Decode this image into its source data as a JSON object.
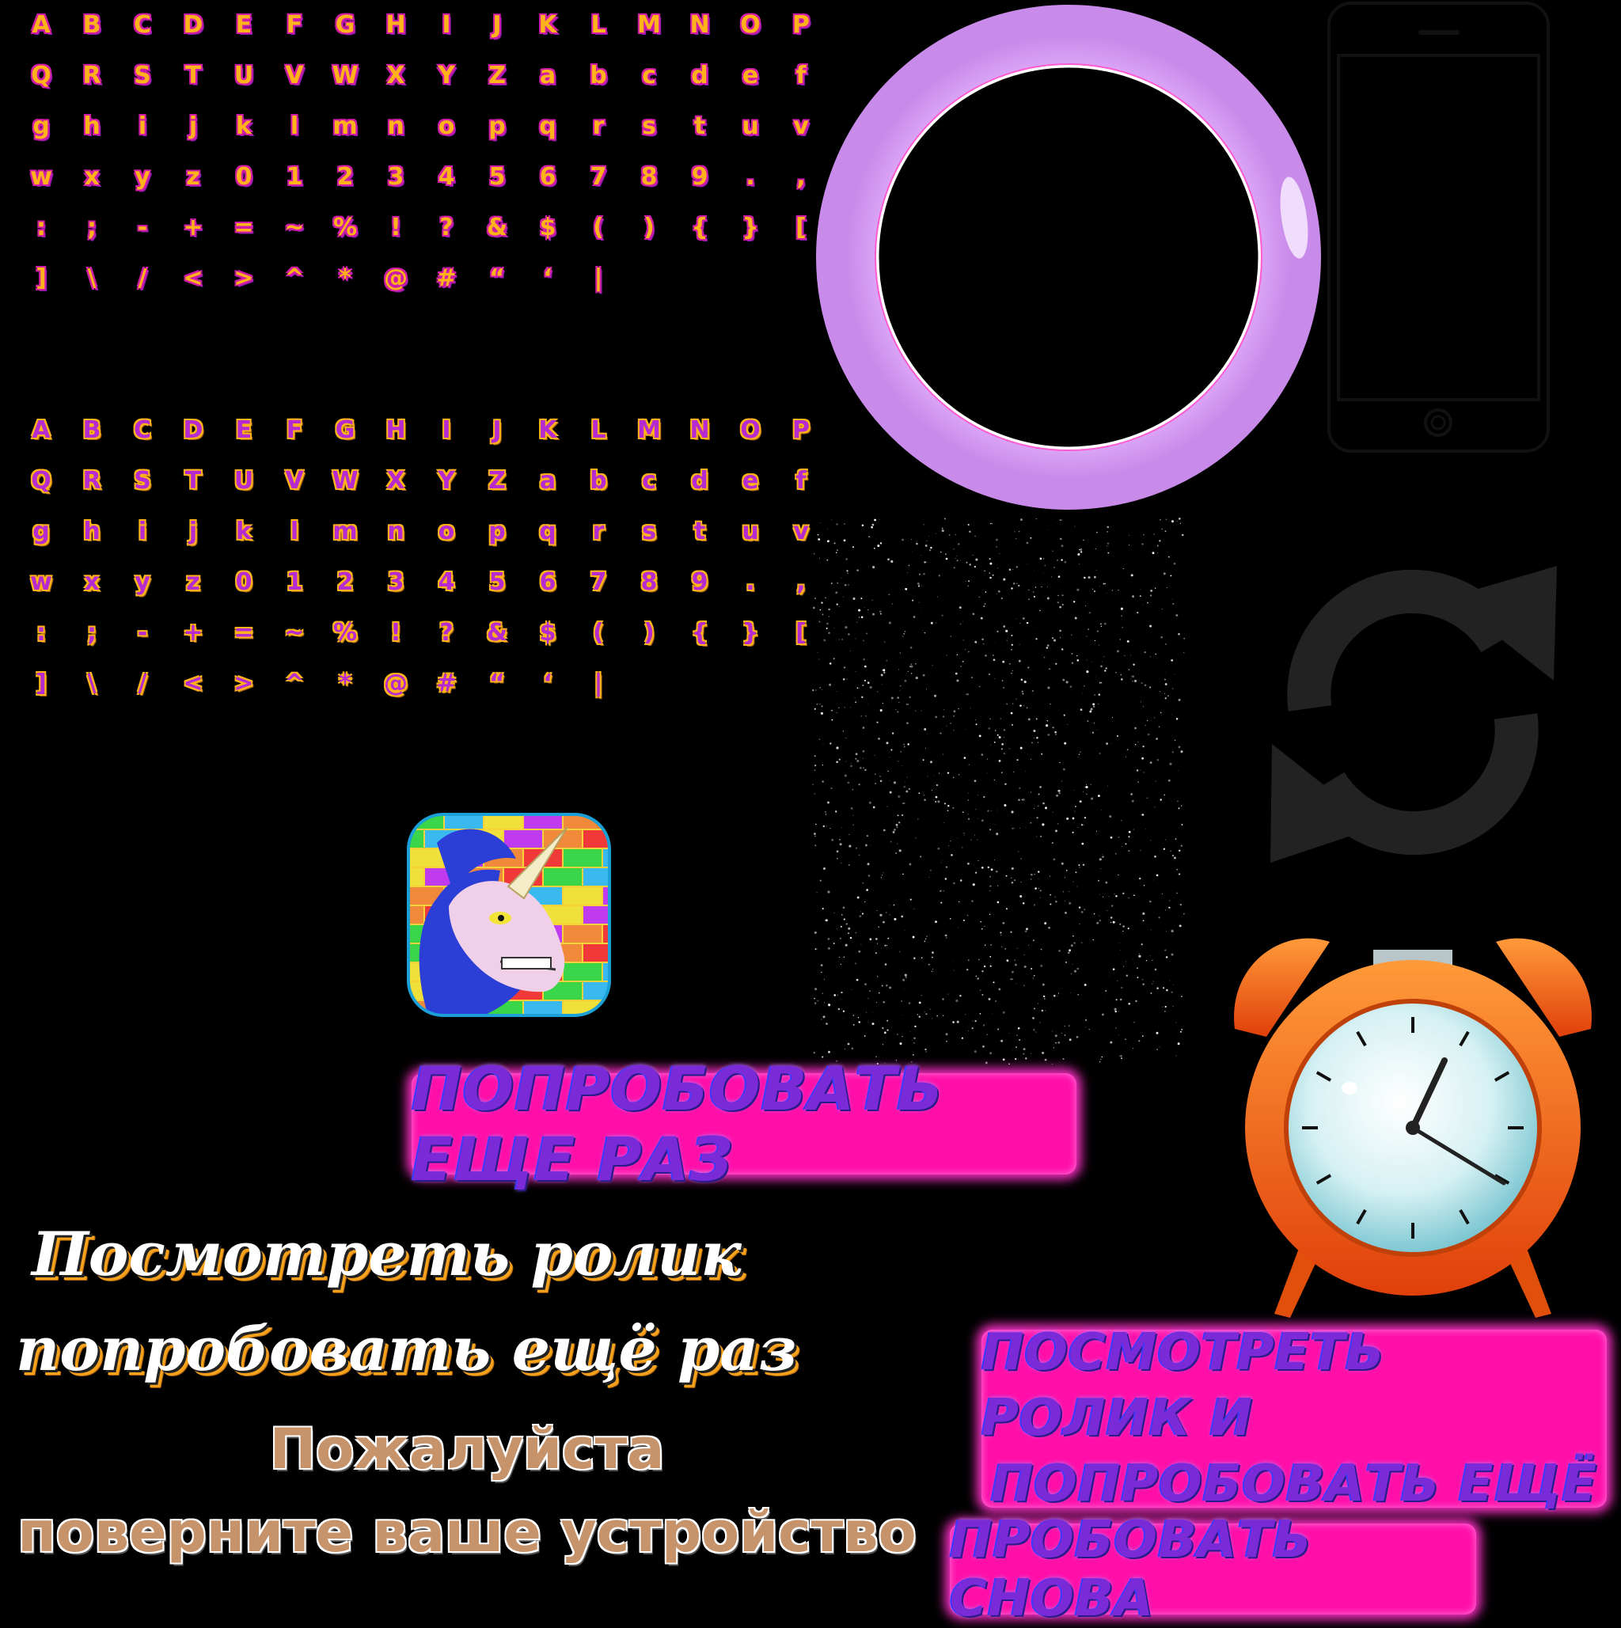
{
  "fonts": {
    "pink_set": [
      "A",
      "B",
      "C",
      "D",
      "E",
      "F",
      "G",
      "H",
      "I",
      "J",
      "K",
      "L",
      "M",
      "N",
      "O",
      "P",
      "Q",
      "R",
      "S",
      "T",
      "U",
      "V",
      "W",
      "X",
      "Y",
      "Z",
      "a",
      "b",
      "c",
      "d",
      "e",
      "f",
      "g",
      "h",
      "i",
      "j",
      "k",
      "l",
      "m",
      "n",
      "o",
      "p",
      "q",
      "r",
      "s",
      "t",
      "u",
      "v",
      "w",
      "x",
      "y",
      "z",
      "0",
      "1",
      "2",
      "3",
      "4",
      "5",
      "6",
      "7",
      "8",
      "9",
      ".",
      ",",
      ":",
      ";",
      "-",
      "+",
      "=",
      "~",
      "%",
      "!",
      "?",
      "&",
      "$",
      "(",
      ")",
      "{",
      "}",
      "[",
      "]",
      "\\",
      "/",
      "<",
      ">",
      "^",
      "*",
      "@",
      "#",
      "“",
      "‘",
      "|"
    ],
    "orange_set": [
      "A",
      "B",
      "C",
      "D",
      "E",
      "F",
      "G",
      "H",
      "I",
      "J",
      "K",
      "L",
      "M",
      "N",
      "O",
      "P",
      "Q",
      "R",
      "S",
      "T",
      "U",
      "V",
      "W",
      "X",
      "Y",
      "Z",
      "a",
      "b",
      "c",
      "d",
      "e",
      "f",
      "g",
      "h",
      "i",
      "j",
      "k",
      "l",
      "m",
      "n",
      "o",
      "p",
      "q",
      "r",
      "s",
      "t",
      "u",
      "v",
      "w",
      "x",
      "y",
      "z",
      "0",
      "1",
      "2",
      "3",
      "4",
      "5",
      "6",
      "7",
      "8",
      "9",
      ".",
      ",",
      ":",
      ";",
      "-",
      "+",
      "=",
      "~",
      "%",
      "!",
      "?",
      "&",
      "$",
      "(",
      ")",
      "{",
      "}",
      "[",
      "]",
      "\\",
      "/",
      "<",
      ">",
      "^",
      "*",
      "@",
      "#",
      "“",
      "‘",
      "|"
    ]
  },
  "buttons": {
    "try_again": "попробовать еще раз",
    "watch_and_retry_line1": "посмотреть ролик и",
    "watch_and_retry_line2": "попробовать ещё",
    "try_again_alt": "пробовать снова"
  },
  "texts": {
    "watch_video_line1": "Посмотреть ролик",
    "watch_video_line2": "попробовать ещё раз",
    "rotate_line1": "Пожалуйста",
    "rotate_line2": "поверните ваше устройство"
  },
  "icons": {
    "ring": "ring-frame-icon",
    "phone": "phone-outline-icon",
    "refresh": "refresh-arrows-icon",
    "clock": "alarm-clock-icon",
    "unicorn": "unicorn-app-icon",
    "stars": "starfield-texture"
  },
  "colors": {
    "ring_purple": "#d99cf5",
    "neon_pink": "#ff0fa8",
    "neon_text": "#7a2ad6",
    "clock_orange": "#f26a12",
    "clock_face": "#bfe8ec",
    "refresh_gray": "#222222"
  }
}
